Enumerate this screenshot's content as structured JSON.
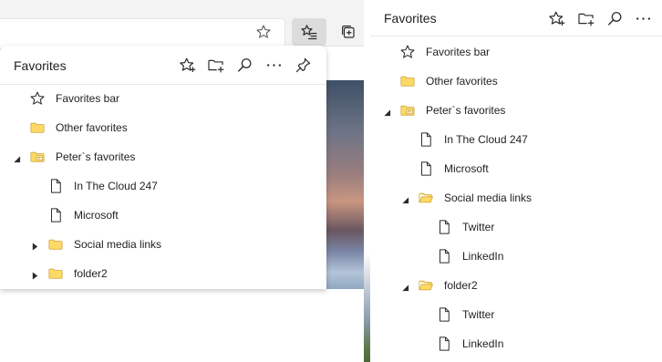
{
  "colors": {
    "folder_fill": "#ffd966",
    "folder_stroke": "#c8a235",
    "icon_stroke": "#2b2b2b",
    "active_button_bg": "#dcdcdc"
  },
  "browser": {
    "address_star_icon": "star-outline",
    "favorites_button_icon": "favorites-list-icon",
    "collections_icon": "collections-icon"
  },
  "flyout": {
    "title": "Favorites",
    "actions": [
      "add-favorite",
      "add-folder",
      "search",
      "more",
      "pin"
    ],
    "items": [
      {
        "label": "Favorites bar",
        "icon": "star",
        "depth": 0,
        "twisty": "none"
      },
      {
        "label": "Other favorites",
        "icon": "folder",
        "depth": 0,
        "twisty": "none"
      },
      {
        "label": "Peter`s favorites",
        "icon": "folder-shared",
        "depth": 0,
        "twisty": "expanded"
      },
      {
        "label": "In The Cloud 247",
        "icon": "page",
        "depth": 1,
        "twisty": "none"
      },
      {
        "label": "Microsoft",
        "icon": "page",
        "depth": 1,
        "twisty": "none"
      },
      {
        "label": "Social media links",
        "icon": "folder",
        "depth": 1,
        "twisty": "collapsed"
      },
      {
        "label": "folder2",
        "icon": "folder",
        "depth": 1,
        "twisty": "collapsed"
      }
    ]
  },
  "pane": {
    "title": "Favorites",
    "actions": [
      "add-favorite",
      "add-folder",
      "search",
      "more"
    ],
    "items": [
      {
        "label": "Favorites bar",
        "icon": "star",
        "depth": 0,
        "twisty": "none"
      },
      {
        "label": "Other favorites",
        "icon": "folder",
        "depth": 0,
        "twisty": "none"
      },
      {
        "label": "Peter`s favorites",
        "icon": "folder-shared",
        "depth": 0,
        "twisty": "expanded"
      },
      {
        "label": "In The Cloud 247",
        "icon": "page",
        "depth": 1,
        "twisty": "none"
      },
      {
        "label": "Microsoft",
        "icon": "page",
        "depth": 1,
        "twisty": "none"
      },
      {
        "label": "Social media links",
        "icon": "folder-open",
        "depth": 1,
        "twisty": "expanded"
      },
      {
        "label": "Twitter",
        "icon": "page",
        "depth": 2,
        "twisty": "none"
      },
      {
        "label": "LinkedIn",
        "icon": "page",
        "depth": 2,
        "twisty": "none"
      },
      {
        "label": "folder2",
        "icon": "folder-open",
        "depth": 1,
        "twisty": "expanded"
      },
      {
        "label": "Twitter",
        "icon": "page",
        "depth": 2,
        "twisty": "none"
      },
      {
        "label": "LinkedIn",
        "icon": "page",
        "depth": 2,
        "twisty": "none"
      }
    ]
  }
}
